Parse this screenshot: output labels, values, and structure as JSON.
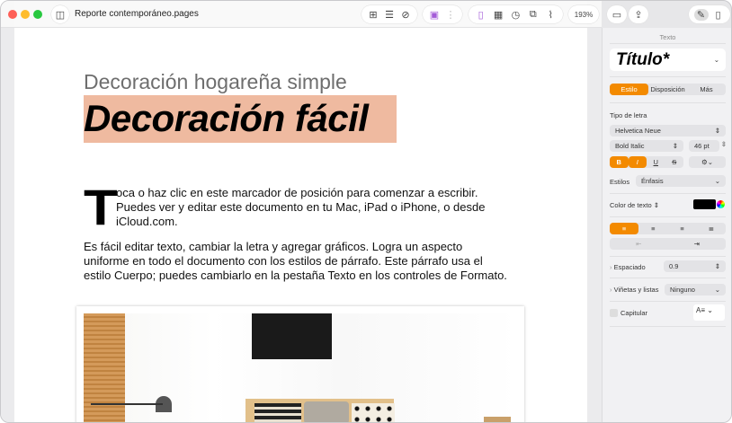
{
  "window": {
    "title": "Reporte contemporáneo.pages",
    "zoom": "193%"
  },
  "toolbar": {
    "icons": [
      "sidebar-icon",
      "add-page-icon",
      "list-icon",
      "shape-icon",
      "media-icon",
      "chart-icon",
      "text-box-icon",
      "table-icon",
      "clock-icon",
      "copy-icon",
      "attach-icon",
      "comment-icon",
      "share-icon",
      "format-icon",
      "document-icon"
    ]
  },
  "document": {
    "subtitle": "Decoración hogareña simple",
    "title": "Decoración fácil",
    "dropcap": "T",
    "para1": [
      "oca o haz clic en este marcador de posición para comenzar a escribir.",
      "Puedes ver y editar este documento en tu Mac, iPad o iPhone, o desde",
      "iCloud.com."
    ],
    "para2": [
      "Es fácil editar texto, cambiar la letra y agregar gráficos. Logra un aspecto",
      "uniforme en todo el documento con los estilos de párrafo. Este párrafo usa el",
      "estilo Cuerpo; puedes cambiarlo en la pestaña Texto en los controles de Formato."
    ]
  },
  "sidebar": {
    "header": "Texto",
    "style_name": "Título*",
    "tabs": [
      "Estilo",
      "Disposición",
      "Más"
    ],
    "font_label": "Tipo de letra",
    "font": "Helvetica Neue",
    "typeface": "Bold Italic",
    "size": "46 pt",
    "bius": [
      "B",
      "I",
      "U",
      "S"
    ],
    "styles_label": "Estilos",
    "styles_value": "Énfasis",
    "color_label": "Color de texto ⇕",
    "text_color": "#000000",
    "accent": "#f38a00",
    "spacing_label": "Espaciado",
    "spacing_value": "0.9",
    "bullets_label": "Viñetas y listas",
    "bullets_value": "Ninguno",
    "dropcap_label": "Capitular"
  }
}
